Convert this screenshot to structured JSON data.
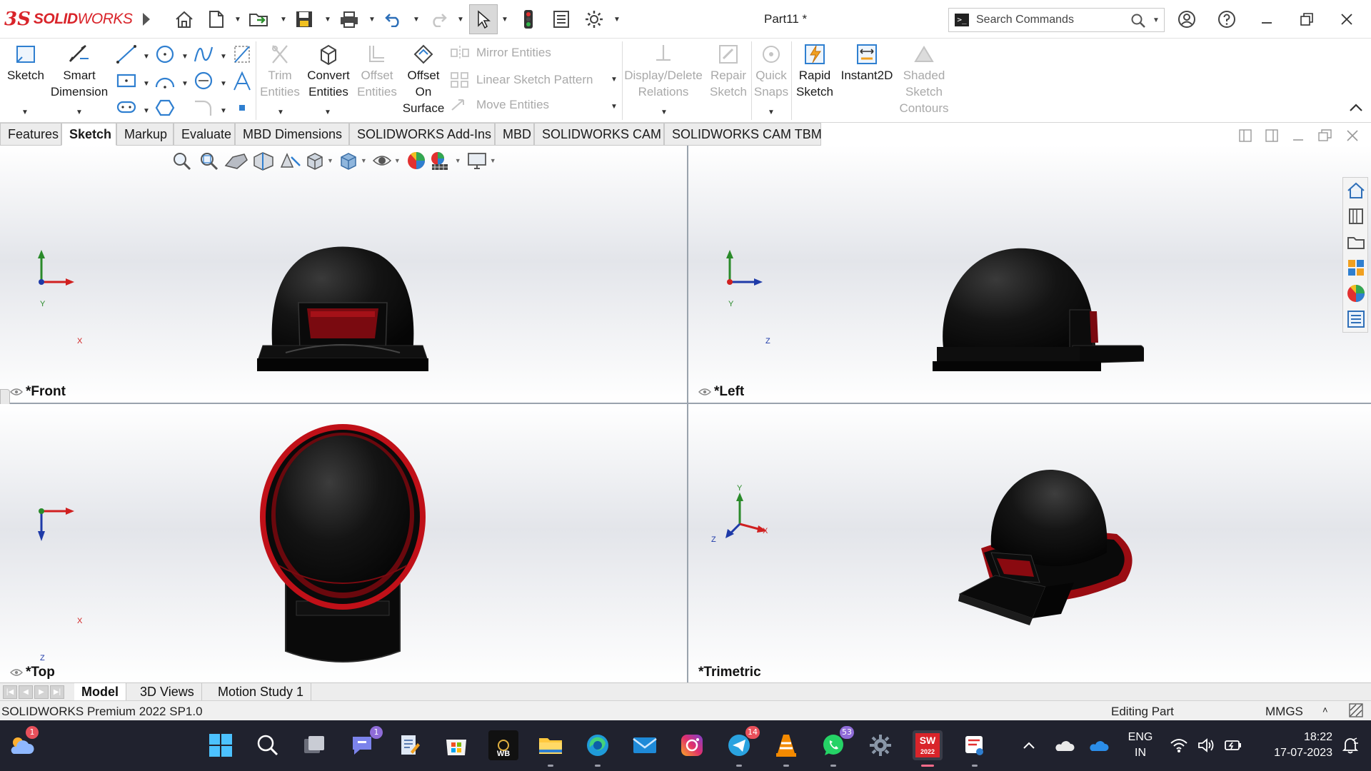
{
  "app": {
    "brand_ds": "3S",
    "brand_solid": "SOLID",
    "brand_works": "WORKS",
    "document_title": "Part11 *"
  },
  "search": {
    "placeholder": "Search Commands",
    "prompt_glyph": ">_"
  },
  "ribbon": {
    "sketch": "Sketch",
    "smart_dimension_1": "Smart",
    "smart_dimension_2": "Dimension",
    "trim_1": "Trim",
    "trim_2": "Entities",
    "convert_1": "Convert",
    "convert_2": "Entities",
    "offset_1": "Offset",
    "offset_2": "Entities",
    "offset_surface_1": "Offset",
    "offset_surface_2": "On",
    "offset_surface_3": "Surface",
    "mirror": "Mirror Entities",
    "linear_pattern": "Linear Sketch Pattern",
    "move": "Move Entities",
    "display_delete_1": "Display/Delete",
    "display_delete_2": "Relations",
    "repair_1": "Repair",
    "repair_2": "Sketch",
    "quick_snaps_1": "Quick",
    "quick_snaps_2": "Snaps",
    "rapid_1": "Rapid",
    "rapid_2": "Sketch",
    "instant2d": "Instant2D",
    "shaded_1": "Shaded",
    "shaded_2": "Sketch",
    "shaded_3": "Contours"
  },
  "tabs": [
    "Features",
    "Sketch",
    "Markup",
    "Evaluate",
    "MBD Dimensions",
    "SOLIDWORKS Add-Ins",
    "MBD",
    "SOLIDWORKS CAM",
    "SOLIDWORKS CAM TBM"
  ],
  "viewports": {
    "front": "*Front",
    "left": "*Left",
    "top": "*Top",
    "trimetric": "*Trimetric"
  },
  "axes": {
    "x": "X",
    "y": "Y",
    "z": "Z"
  },
  "model_tabs": [
    "Model",
    "3D Views",
    "Motion Study 1"
  ],
  "status": {
    "product": "SOLIDWORKS Premium 2022 SP1.0",
    "mode": "Editing Part",
    "units": "MMGS",
    "units_caret": "˄"
  },
  "taskbar": {
    "weather_badge": "1",
    "teams_badge": "1",
    "telegram_badge": "14",
    "whatsapp_badge": "53",
    "wb_label": "WB",
    "sw_label": "SW",
    "sw_year": "2022",
    "lang_1": "ENG",
    "lang_2": "IN",
    "time": "18:22",
    "date": "17-07-2023"
  },
  "colors": {
    "accent_red": "#d9242a",
    "helmet_black": "#0b0b0b",
    "helmet_red": "#8a0a0f",
    "taskbar": "#20222e"
  }
}
